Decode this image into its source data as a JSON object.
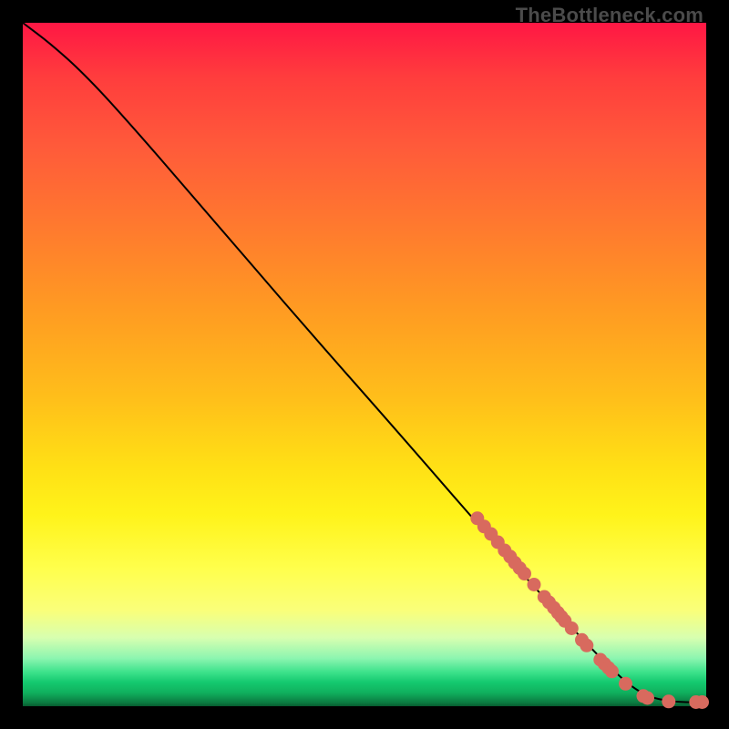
{
  "watermark": "TheBottleneck.com",
  "colors": {
    "marker": "#d86a5e",
    "curve": "#000000",
    "frame": "#000000"
  },
  "chart_data": {
    "type": "line",
    "title": "",
    "xlabel": "",
    "ylabel": "",
    "xlim": [
      0,
      100
    ],
    "ylim": [
      0,
      100
    ],
    "curve": {
      "description": "Monotonic decreasing curve from top-left toward bottom-right; near-linear over most of the range, flattening to ~0 for x≳90.",
      "control_points_xy": [
        [
          0,
          100
        ],
        [
          4,
          97
        ],
        [
          9,
          92.5
        ],
        [
          15,
          86
        ],
        [
          25,
          74.5
        ],
        [
          40,
          57
        ],
        [
          55,
          40
        ],
        [
          68,
          25
        ],
        [
          78,
          14
        ],
        [
          85,
          6.5
        ],
        [
          90,
          2
        ],
        [
          94,
          0.7
        ],
        [
          100,
          0.5
        ]
      ]
    },
    "series": [
      {
        "name": "highlighted-points",
        "type": "scatter",
        "color": "#d86a5e",
        "points_xy": [
          [
            66.5,
            27.5
          ],
          [
            67.5,
            26.3
          ],
          [
            68.5,
            25.2
          ],
          [
            69.5,
            24.0
          ],
          [
            70.5,
            22.8
          ],
          [
            71.3,
            21.9
          ],
          [
            72.0,
            21.0
          ],
          [
            72.7,
            20.2
          ],
          [
            73.4,
            19.4
          ],
          [
            74.8,
            17.8
          ],
          [
            76.3,
            16.0
          ],
          [
            77.0,
            15.2
          ],
          [
            77.7,
            14.4
          ],
          [
            78.3,
            13.7
          ],
          [
            78.8,
            13.1
          ],
          [
            79.3,
            12.5
          ],
          [
            80.3,
            11.4
          ],
          [
            81.8,
            9.7
          ],
          [
            82.5,
            8.9
          ],
          [
            84.5,
            6.8
          ],
          [
            85.1,
            6.2
          ],
          [
            85.7,
            5.6
          ],
          [
            86.2,
            5.1
          ],
          [
            88.2,
            3.3
          ],
          [
            90.8,
            1.5
          ],
          [
            91.4,
            1.2
          ],
          [
            94.5,
            0.7
          ],
          [
            98.5,
            0.6
          ],
          [
            99.4,
            0.6
          ]
        ]
      }
    ]
  }
}
